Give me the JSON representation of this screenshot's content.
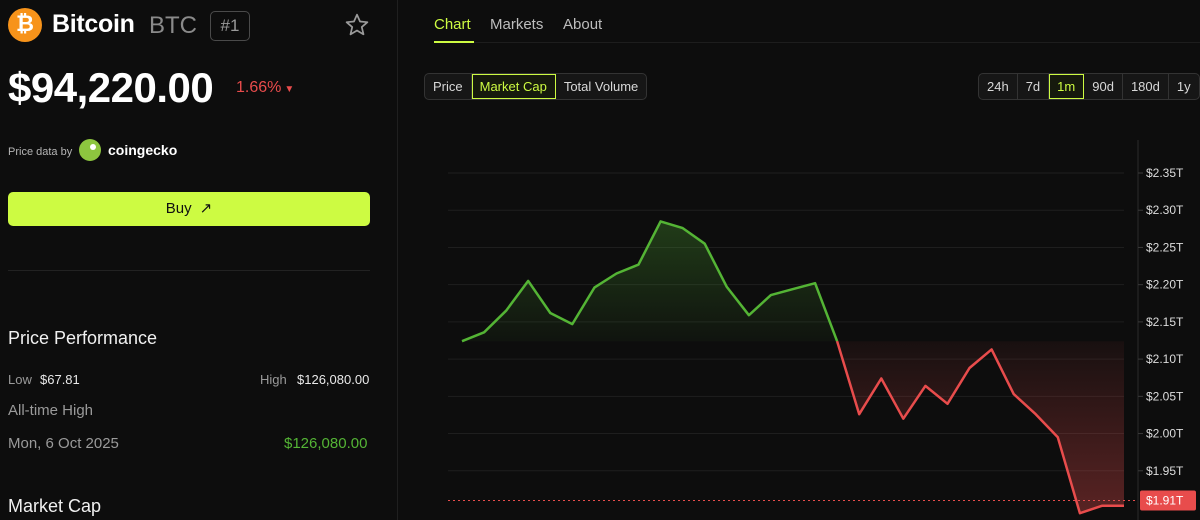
{
  "coin": {
    "logo_symbol": "₿",
    "name": "Bitcoin",
    "symbol": "BTC",
    "rank": "#1"
  },
  "price": {
    "value": "$94,220.00",
    "change": "1.66%",
    "direction": "down"
  },
  "source": {
    "label": "Price data by",
    "name": "coingecko"
  },
  "buy": {
    "label": "Buy",
    "arrow": "↗"
  },
  "performance": {
    "title": "Price Performance",
    "low_label": "Low",
    "low_value": "$67.81",
    "high_label": "High",
    "high_value": "$126,080.00",
    "ath_label": "All-time High",
    "ath_date": "Mon, 6 Oct 2025",
    "ath_value": "$126,080.00"
  },
  "market_cap": {
    "title": "Market Cap"
  },
  "tabs": [
    "Chart",
    "Markets",
    "About"
  ],
  "chart_types": [
    "Price",
    "Market Cap",
    "Total Volume"
  ],
  "selected_chart_type": "Market Cap",
  "ranges": [
    "24h",
    "7d",
    "1m",
    "90d",
    "180d",
    "1y"
  ],
  "selected_range": "1m",
  "colors": {
    "accent": "#cdfb42",
    "up": "#54b435",
    "down": "#e84c4c",
    "brand": "#f7931a"
  },
  "chart_data": {
    "type": "line",
    "y_ticks": [
      "$2.35T",
      "$2.30T",
      "$2.25T",
      "$2.20T",
      "$2.15T",
      "$2.10T",
      "$2.05T",
      "$2.00T",
      "$1.95T"
    ],
    "y_tick_values": [
      2.35,
      2.3,
      2.25,
      2.2,
      2.15,
      2.1,
      2.05,
      2.0,
      1.95
    ],
    "ylim": [
      1.91,
      2.36
    ],
    "baseline": 2.124,
    "current_label": "$1.91T",
    "current_value": 1.91,
    "values": [
      2.124,
      2.136,
      2.165,
      2.205,
      2.162,
      2.147,
      2.196,
      2.215,
      2.227,
      2.285,
      2.276,
      2.255,
      2.197,
      2.159,
      2.186,
      2.194,
      2.202,
      2.124,
      2.026,
      2.074,
      2.02,
      2.064,
      2.04,
      2.088,
      2.113,
      2.053,
      2.026,
      1.995,
      1.893,
      1.903,
      1.903
    ]
  }
}
